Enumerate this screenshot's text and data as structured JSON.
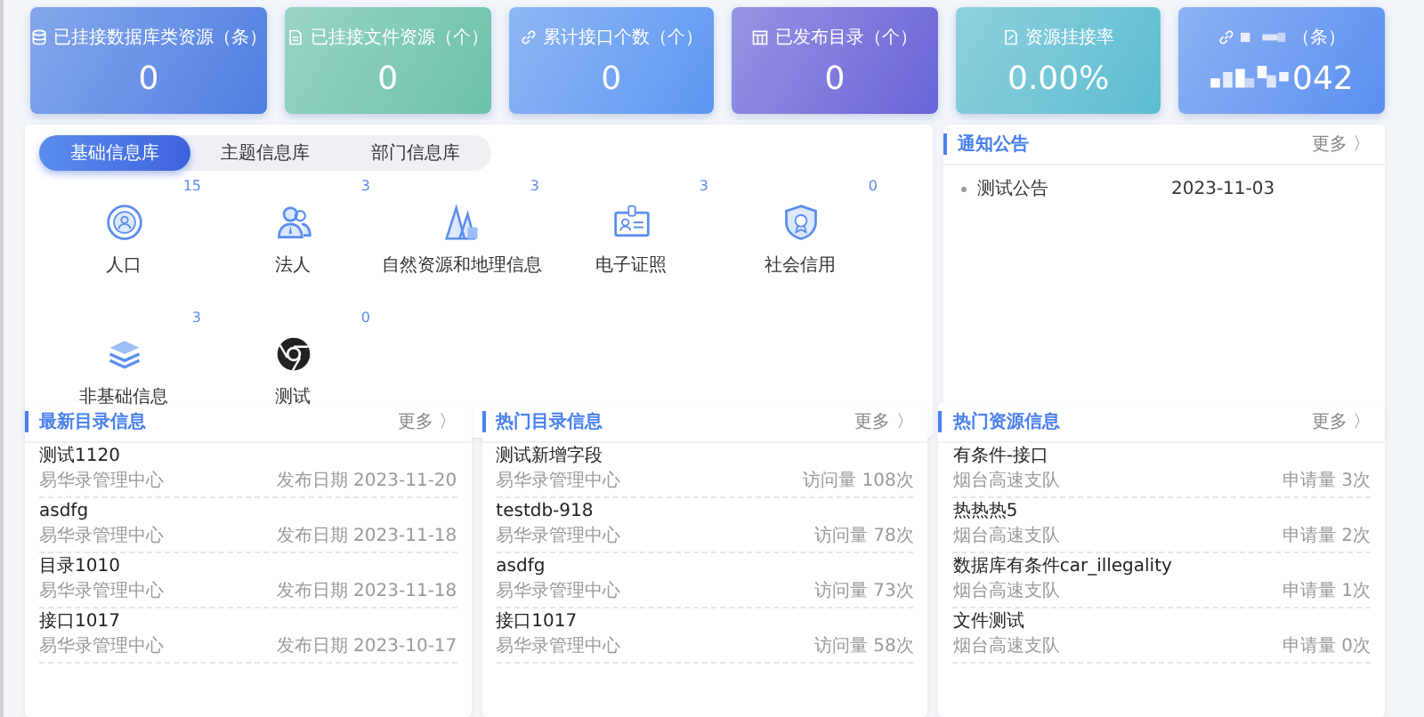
{
  "stat_cards": [
    {
      "label": "已挂接数据库类资源（条）",
      "value": "0",
      "color": "#4f7fe3",
      "redacted": false
    },
    {
      "label": "已挂接文件资源（个）",
      "value": "0",
      "color": "#6cc2aa",
      "redacted": false
    },
    {
      "label": "累计接口个数（个）",
      "value": "0",
      "color": "#5d97f2",
      "redacted": false
    },
    {
      "label": "已发布目录（个）",
      "value": "0",
      "color": "#6a63d8",
      "redacted": false
    },
    {
      "label": "资源挂接率",
      "value": "0.00%",
      "color": "#5cbdd0",
      "redacted": false
    },
    {
      "label": "（条）",
      "value": "042",
      "color": "#5a8ff0",
      "redacted": true
    }
  ],
  "info_library": {
    "tabs": [
      {
        "label": "基础信息库",
        "selected": true
      },
      {
        "label": "主题信息库",
        "selected": false
      },
      {
        "label": "部门信息库",
        "selected": false
      }
    ],
    "items": [
      {
        "label": "人口",
        "count": "15"
      },
      {
        "label": "法人",
        "count": "3"
      },
      {
        "label": "自然资源和地理信息",
        "count": "3"
      },
      {
        "label": "电子证照",
        "count": "3"
      },
      {
        "label": "社会信用",
        "count": "0"
      },
      {
        "label": "非基础信息",
        "count": "3"
      },
      {
        "label": "测试",
        "count": "0"
      }
    ]
  },
  "notices": {
    "title": "通知公告",
    "more": "更多 〉",
    "items": [
      {
        "title": "测试公告",
        "date": "2023-11-03"
      }
    ]
  },
  "lists": [
    {
      "title": "最新目录信息",
      "more": "更多 〉",
      "rows": [
        {
          "name": "测试1120",
          "org": "易华录管理中心",
          "meta": "发布日期 2023-11-20"
        },
        {
          "name": "asdfg",
          "org": "易华录管理中心",
          "meta": "发布日期 2023-11-18"
        },
        {
          "name": "目录1010",
          "org": "易华录管理中心",
          "meta": "发布日期 2023-11-18"
        },
        {
          "name": "接口1017",
          "org": "易华录管理中心",
          "meta": "发布日期 2023-10-17"
        }
      ]
    },
    {
      "title": "热门目录信息",
      "more": "更多 〉",
      "rows": [
        {
          "name": "测试新增字段",
          "org": "易华录管理中心",
          "meta": "访问量 108次"
        },
        {
          "name": "testdb-918",
          "org": "易华录管理中心",
          "meta": "访问量 78次"
        },
        {
          "name": "asdfg",
          "org": "易华录管理中心",
          "meta": "访问量 73次"
        },
        {
          "name": "接口1017",
          "org": "易华录管理中心",
          "meta": "访问量 58次"
        }
      ]
    },
    {
      "title": "热门资源信息",
      "more": "更多 〉",
      "rows": [
        {
          "name": "有条件-接口",
          "org": "烟台高速支队",
          "meta": "申请量 3次"
        },
        {
          "name": "热热热5",
          "org": "烟台高速支队",
          "meta": "申请量 2次"
        },
        {
          "name": "数据库有条件car_illegality",
          "org": "烟台高速支队",
          "meta": "申请量 1次"
        },
        {
          "name": "文件测试",
          "org": "烟台高速支队",
          "meta": "申请量 0次"
        }
      ]
    }
  ]
}
